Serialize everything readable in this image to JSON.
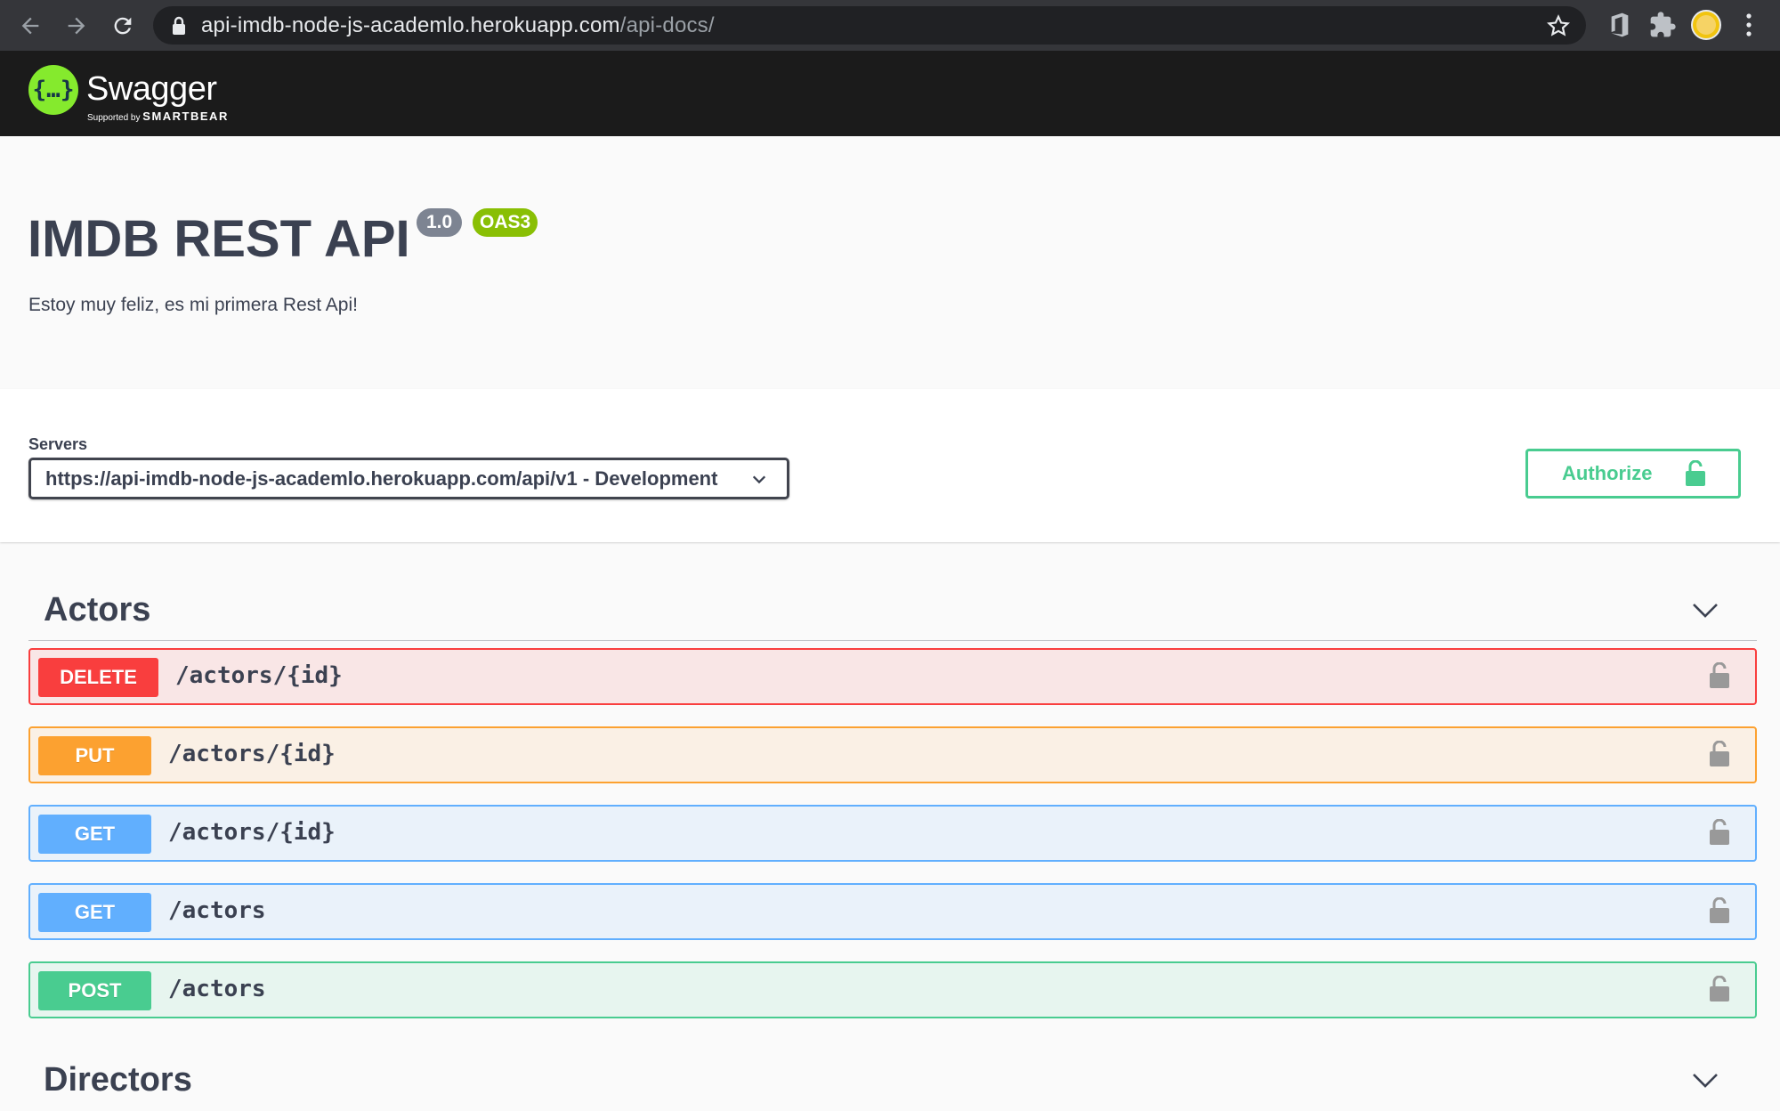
{
  "browser": {
    "url_host": "api-imdb-node-js-academlo.herokuapp.com",
    "url_path": "/api-docs/",
    "icons": [
      "back-icon",
      "forward-icon",
      "reload-icon",
      "lock-icon",
      "star-icon",
      "office-extension-icon",
      "puzzle-extension-icon",
      "profile-avatar",
      "menu-icon"
    ]
  },
  "topbar": {
    "logo_symbol": "{…}",
    "logo_text": "Swagger",
    "logo_sub_prefix": "Supported by",
    "logo_sub_brand": "SMARTBEAR"
  },
  "info": {
    "title": "IMDB REST API",
    "version": "1.0",
    "spec": "OAS3",
    "description": "Estoy muy feliz, es mi primera Rest Api!"
  },
  "scheme": {
    "servers_label": "Servers",
    "selected_server": "https://api-imdb-node-js-academlo.herokuapp.com/api/v1 - Development",
    "authorize_label": "Authorize"
  },
  "tags": [
    {
      "name": "Actors",
      "operations": [
        {
          "method": "DELETE",
          "path": "/actors/{id}"
        },
        {
          "method": "PUT",
          "path": "/actors/{id}"
        },
        {
          "method": "GET",
          "path": "/actors/{id}"
        },
        {
          "method": "GET",
          "path": "/actors"
        },
        {
          "method": "POST",
          "path": "/actors"
        }
      ]
    },
    {
      "name": "Directors",
      "operations": []
    }
  ],
  "colors": {
    "delete": "#f93e3e",
    "put": "#fca130",
    "get": "#61affe",
    "post": "#49cc90",
    "oas_badge": "#89bf04",
    "version_badge": "#7d8492"
  }
}
